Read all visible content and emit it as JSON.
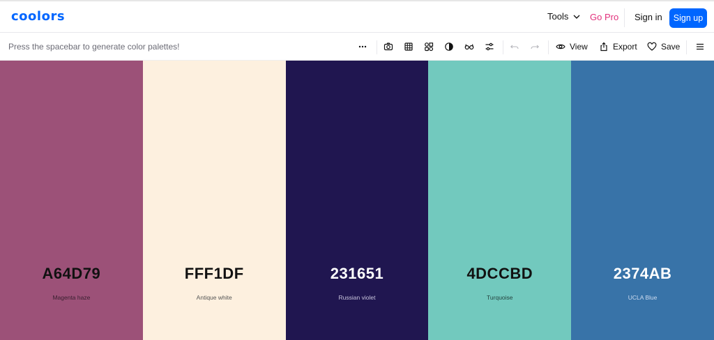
{
  "header": {
    "logo": "coolors",
    "tools_label": "Tools",
    "gopro_label": "Go Pro",
    "signin_label": "Sign in",
    "signup_label": "Sign up",
    "brand_color": "#0066ff",
    "pro_color": "#e2317c"
  },
  "toolbar": {
    "hint": "Press the spacebar to generate color palettes!",
    "view_label": "View",
    "export_label": "Export",
    "save_label": "Save",
    "icons": [
      "more-icon",
      "camera-icon",
      "grid-icon",
      "shapes-icon",
      "contrast-icon",
      "glasses-icon",
      "sliders-icon",
      "undo-icon",
      "redo-icon",
      "eye-icon",
      "export-icon",
      "heart-icon",
      "menu-icon"
    ]
  },
  "palette": [
    {
      "hex": "A64D79",
      "name": "Magenta haze",
      "color": "#9c5178",
      "text": "#111111",
      "subtext": "#3a2030"
    },
    {
      "hex": "FFF1DF",
      "name": "Antique white",
      "color": "#fdf0df",
      "text": "#111111",
      "subtext": "#555555"
    },
    {
      "hex": "231651",
      "name": "Russian violet",
      "color": "#201650",
      "text": "#ffffff",
      "subtext": "#c9c5dd"
    },
    {
      "hex": "4DCCBD",
      "name": "Turquoise",
      "color": "#72c9be",
      "text": "#111111",
      "subtext": "#24443f"
    },
    {
      "hex": "2374AB",
      "name": "UCLA Blue",
      "color": "#3873a8",
      "text": "#ffffff",
      "subtext": "#cfdcef"
    }
  ]
}
